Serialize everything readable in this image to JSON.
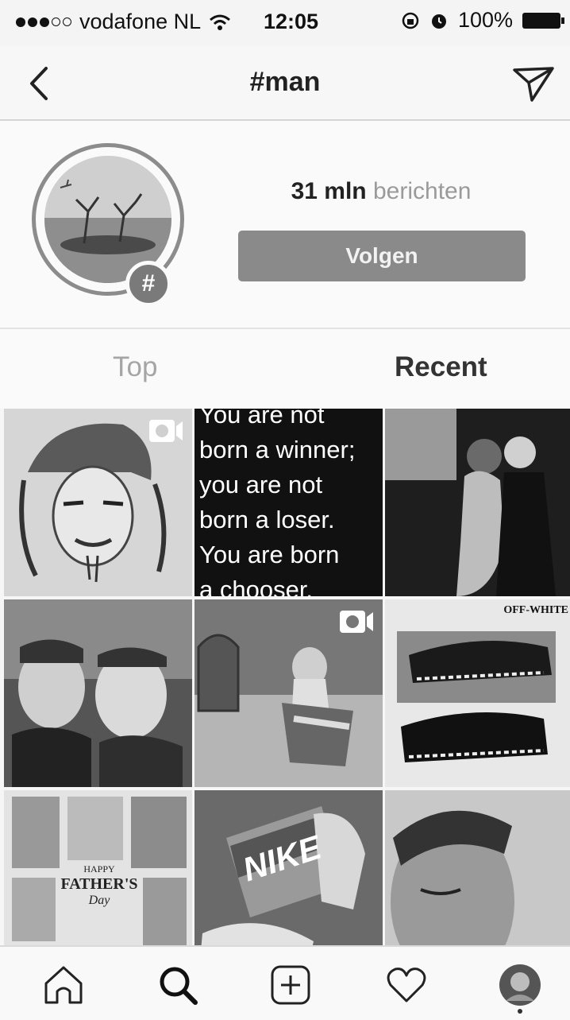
{
  "status_bar": {
    "carrier": "vodafone NL",
    "time": "12:05",
    "battery": "100%"
  },
  "nav": {
    "title": "#man"
  },
  "hashtag": {
    "badge": "#",
    "post_count": "31 mln",
    "post_label": "berichten",
    "follow_label": "Volgen"
  },
  "tabs": {
    "top": "Top",
    "recent": "Recent"
  },
  "grid": {
    "quote_lines": [
      "You are not",
      "born a winner;",
      "you are not",
      "born a loser.",
      "You are born",
      "a chooser."
    ],
    "shoe_brand": "OFF-WHITE",
    "nike_text": "NIKE",
    "fathers_day": {
      "line1": "HAPPY",
      "line2": "FATHER'S",
      "line3": "Day"
    }
  },
  "bottom_nav": {
    "items": [
      "home-icon",
      "search-icon",
      "add-post-icon",
      "activity-heart-icon",
      "profile-avatar"
    ]
  }
}
